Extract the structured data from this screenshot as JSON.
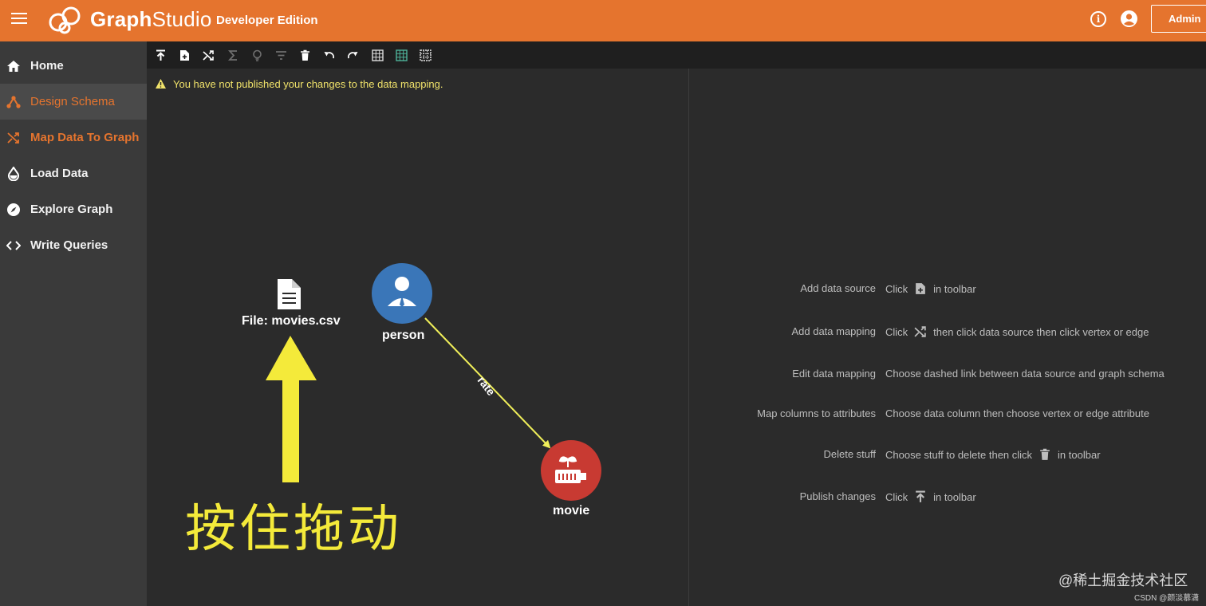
{
  "header": {
    "logo_text_bold": "Graph",
    "logo_text_light": "Studio",
    "edition": "Developer Edition",
    "admin_label": "Admin",
    "info_glyph": "i"
  },
  "sidebar": {
    "items": [
      {
        "label": "Home",
        "icon": "home-icon"
      },
      {
        "label": "Design Schema",
        "icon": "schema-icon"
      },
      {
        "label": "Map Data To Graph",
        "icon": "map-shuffle-icon"
      },
      {
        "label": "Load Data",
        "icon": "drop-icon"
      },
      {
        "label": "Explore Graph",
        "icon": "compass-icon"
      },
      {
        "label": "Write Queries",
        "icon": "code-icon"
      }
    ]
  },
  "toolbar": {
    "tools": [
      "publish-icon",
      "add-file-icon",
      "shuffle-icon",
      "sigma-icon",
      "lightbulb-icon",
      "filter-icon",
      "trash-icon",
      "undo-icon",
      "redo-icon",
      "grid-icon",
      "grid-alt-icon",
      "grid-dotted-icon"
    ]
  },
  "canvas": {
    "warning": "You have not published your changes to the data mapping.",
    "file_label": "File: movies.csv",
    "person_label": "person",
    "movie_label": "movie",
    "edge_label": "rate",
    "annotation": "按住拖动"
  },
  "help": {
    "rows": [
      {
        "key": "Add data source",
        "pre": "Click",
        "icon": "add-file-icon",
        "post": "in toolbar"
      },
      {
        "key": "Add data mapping",
        "pre": "Click",
        "icon": "shuffle-icon",
        "post": "then click data source then click vertex or edge"
      },
      {
        "key": "Edit data mapping",
        "pre": "Choose dashed link between data source and graph schema",
        "icon": "",
        "post": ""
      },
      {
        "key": "Map columns to attributes",
        "pre": "Choose data column then choose vertex or edge attribute",
        "icon": "",
        "post": ""
      },
      {
        "key": "Delete stuff",
        "pre": "Choose stuff to delete then click",
        "icon": "trash-icon",
        "post": "in toolbar"
      },
      {
        "key": "Publish changes",
        "pre": "Click",
        "icon": "publish-icon",
        "post": "in toolbar"
      }
    ]
  },
  "watermark": {
    "line1": "@稀土掘金技术社区",
    "line2": "CSDN @颜淡慕潇"
  },
  "colors": {
    "accent": "#e5742e",
    "person_node": "#3a76b8",
    "movie_node": "#c83a32",
    "edge": "#f0ef5a",
    "annotation": "#f4ea3a",
    "warning": "#f0e26a"
  }
}
